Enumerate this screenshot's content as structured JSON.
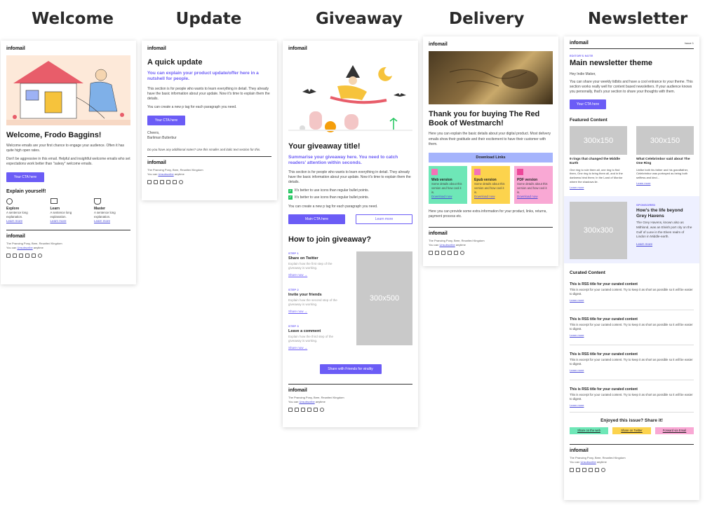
{
  "titles": {
    "welcome": "Welcome",
    "update": "Update",
    "giveaway": "Giveaway",
    "delivery": "Delivery",
    "newsletter": "Newsletter"
  },
  "brand": "infomail",
  "footer": {
    "address": "The Prancing Pony, Bree, Reunited Kingdom",
    "unsub_prefix": "You can",
    "unsub_link": "Unsubscribe",
    "unsub_suffix": "anytime"
  },
  "welcome": {
    "heading": "Welcome, Frodo Baggins!",
    "p1": "Welcome emails are your first chance to engage your audience. Often it has quite high open rates.",
    "p2": "Don't be aggressive in this email. Helpful and insightful welcome emails who set expectations work better than \"salesy\" welcome emails.",
    "cta": "Your CTA here",
    "explain_title": "Explain yourself!",
    "features": [
      {
        "title": "Explore",
        "text": "A sentence long explanation.",
        "link": "Learn more"
      },
      {
        "title": "Learn",
        "text": "A sentence long explanation.",
        "link": "Learn more"
      },
      {
        "title": "Master",
        "text": "A sentence long explanation.",
        "link": "Learn more"
      }
    ]
  },
  "update": {
    "heading": "A quick update",
    "lead": "You can explain your product update/offer here in a nutshell for people.",
    "p1": "This section is for people who wants to learn everything in detail. They already have the basic information about your update. Now it's time to explain them the details.",
    "p2": "You can create a new p tag for each paragraph you need.",
    "cta": "Your CTA here",
    "sign1": "Cheers,",
    "sign2": "Barliman Butterbur",
    "note": "Do you have any additional notes? Use this smaller and italic text section for this."
  },
  "giveaway": {
    "heading": "Your giveaway title!",
    "lead": "Summarise your giveaway here. You need to catch readers' attention within seconds.",
    "p1": "This section is for people who wants to learn everything in detail. They already have the basic information about your update. Now it's time to explain them the details.",
    "bullets": [
      "It's better to use icons than regular bullet points.",
      "It's better to use icons than regular bullet points."
    ],
    "p2": "You can create a new p tag for each paragraph you need.",
    "main_cta": "Main CTA here",
    "learn_more": "Learn more",
    "how_title": "How to join giveaway?",
    "steps": [
      {
        "label": "STEP 1",
        "title": "Share on Twitter",
        "text": "Explain how the first step of the giveaway is working.",
        "link": "Share now →"
      },
      {
        "label": "STEP 2",
        "title": "Invite your friends",
        "text": "Explain how the second step of the giveaway is working.",
        "link": "Share now →"
      },
      {
        "label": "STEP 3",
        "title": "Leave a comment",
        "text": "Explain how the third step of the giveaway is working.",
        "link": "Share now →"
      }
    ],
    "placeholder": "300x500",
    "share_cta": "Share with Friends for virality"
  },
  "delivery": {
    "heading": "Thank you for buying The Red Book of Westmarch!",
    "p1": "Here you can explain the basic details about your digital product. Most delivery emails show their gratitude and their excitement to have their customer with them.",
    "downloads_title": "Download Links",
    "versions": [
      {
        "title": "Web version",
        "text": "Some details about this version and how cool it is.",
        "link": "Download now",
        "color": "#6ee7b7"
      },
      {
        "title": "Epub version",
        "text": "Some details about this version and how cool it is.",
        "link": "Download now",
        "color": "#fcd34d"
      },
      {
        "title": "PDF version",
        "text": "Some details about this version and how cool it is.",
        "link": "Download now",
        "color": "#f9a8d4"
      }
    ],
    "p2": "Here you can provide some extra information for your product, links, returns, payment process etc."
  },
  "newsletter": {
    "issue": "Issue 1",
    "editors_note": "EDITOR'S NOTE",
    "heading": "Main newsletter theme",
    "greeting": "Hey Indie Maker,",
    "p1": "You can share your weekly tidbits and have a cool entrance to your theme. This section works really well for content based newsletters. If your audience knows you personally, that's your section to share your thoughts with them.",
    "cta": "Your CTA here",
    "featured_title": "Featured Content",
    "featured": [
      {
        "img": "300x150",
        "title": "9 rings that changed the Middle Earth",
        "text": "One ring to rule them all, one ring to find them, One ring to bring them all, and in the darkness bind them; In the Land of Mordor where the shadows lie.",
        "link": "Learn more"
      },
      {
        "img": "300x150",
        "title": "What Celebrimbor said about The One Ring",
        "text": "Unlike both his father and his grandfather, Celebrimbor was portrayed as being both selfless and kind...",
        "link": "Learn more"
      }
    ],
    "sponsored_label": "SPONSORED",
    "sponsored_img": "300x300",
    "sponsored_title": "How's the life beyond Grey Havens",
    "sponsored_text": "The Grey Havens, known also as Mithlond, was an Elvish port city on the Gulf of Lune in the Elven realm of Lindon in Middle-earth.",
    "sponsored_link": "Learn more",
    "curated_title": "Curated Content",
    "curated": [
      {
        "title": "This is RSS title for your curated content",
        "text": "This is excerpt for your curated content. Try to keep it as short as possible so it will be easier to digest.",
        "link": "Learn more"
      },
      {
        "title": "This is RSS title for your curated content",
        "text": "This is excerpt for your curated content. Try to keep it as short as possible so it will be easier to digest.",
        "link": "Learn more"
      },
      {
        "title": "This is RSS title for your curated content",
        "text": "This is excerpt for your curated content. Try to keep it as short as possible so it will be easier to digest.",
        "link": "Learn more"
      },
      {
        "title": "This is RSS title for your curated content",
        "text": "This is excerpt for your curated content. Try to keep it as short as possible so it will be easier to digest.",
        "link": "Learn more"
      }
    ],
    "share_title": "Enjoyed this issue? Share it!",
    "share_buttons": [
      {
        "label": "Share on the web",
        "color": "#6ee7b7"
      },
      {
        "label": "Share on Twitter",
        "color": "#fcd34d"
      },
      {
        "label": "Forward via Email",
        "color": "#f9a8d4"
      }
    ]
  },
  "colors": {
    "accent": "#6b5cf6",
    "download_bar": "#a5b4fc",
    "sponsored_bg": "#eef0ff"
  }
}
